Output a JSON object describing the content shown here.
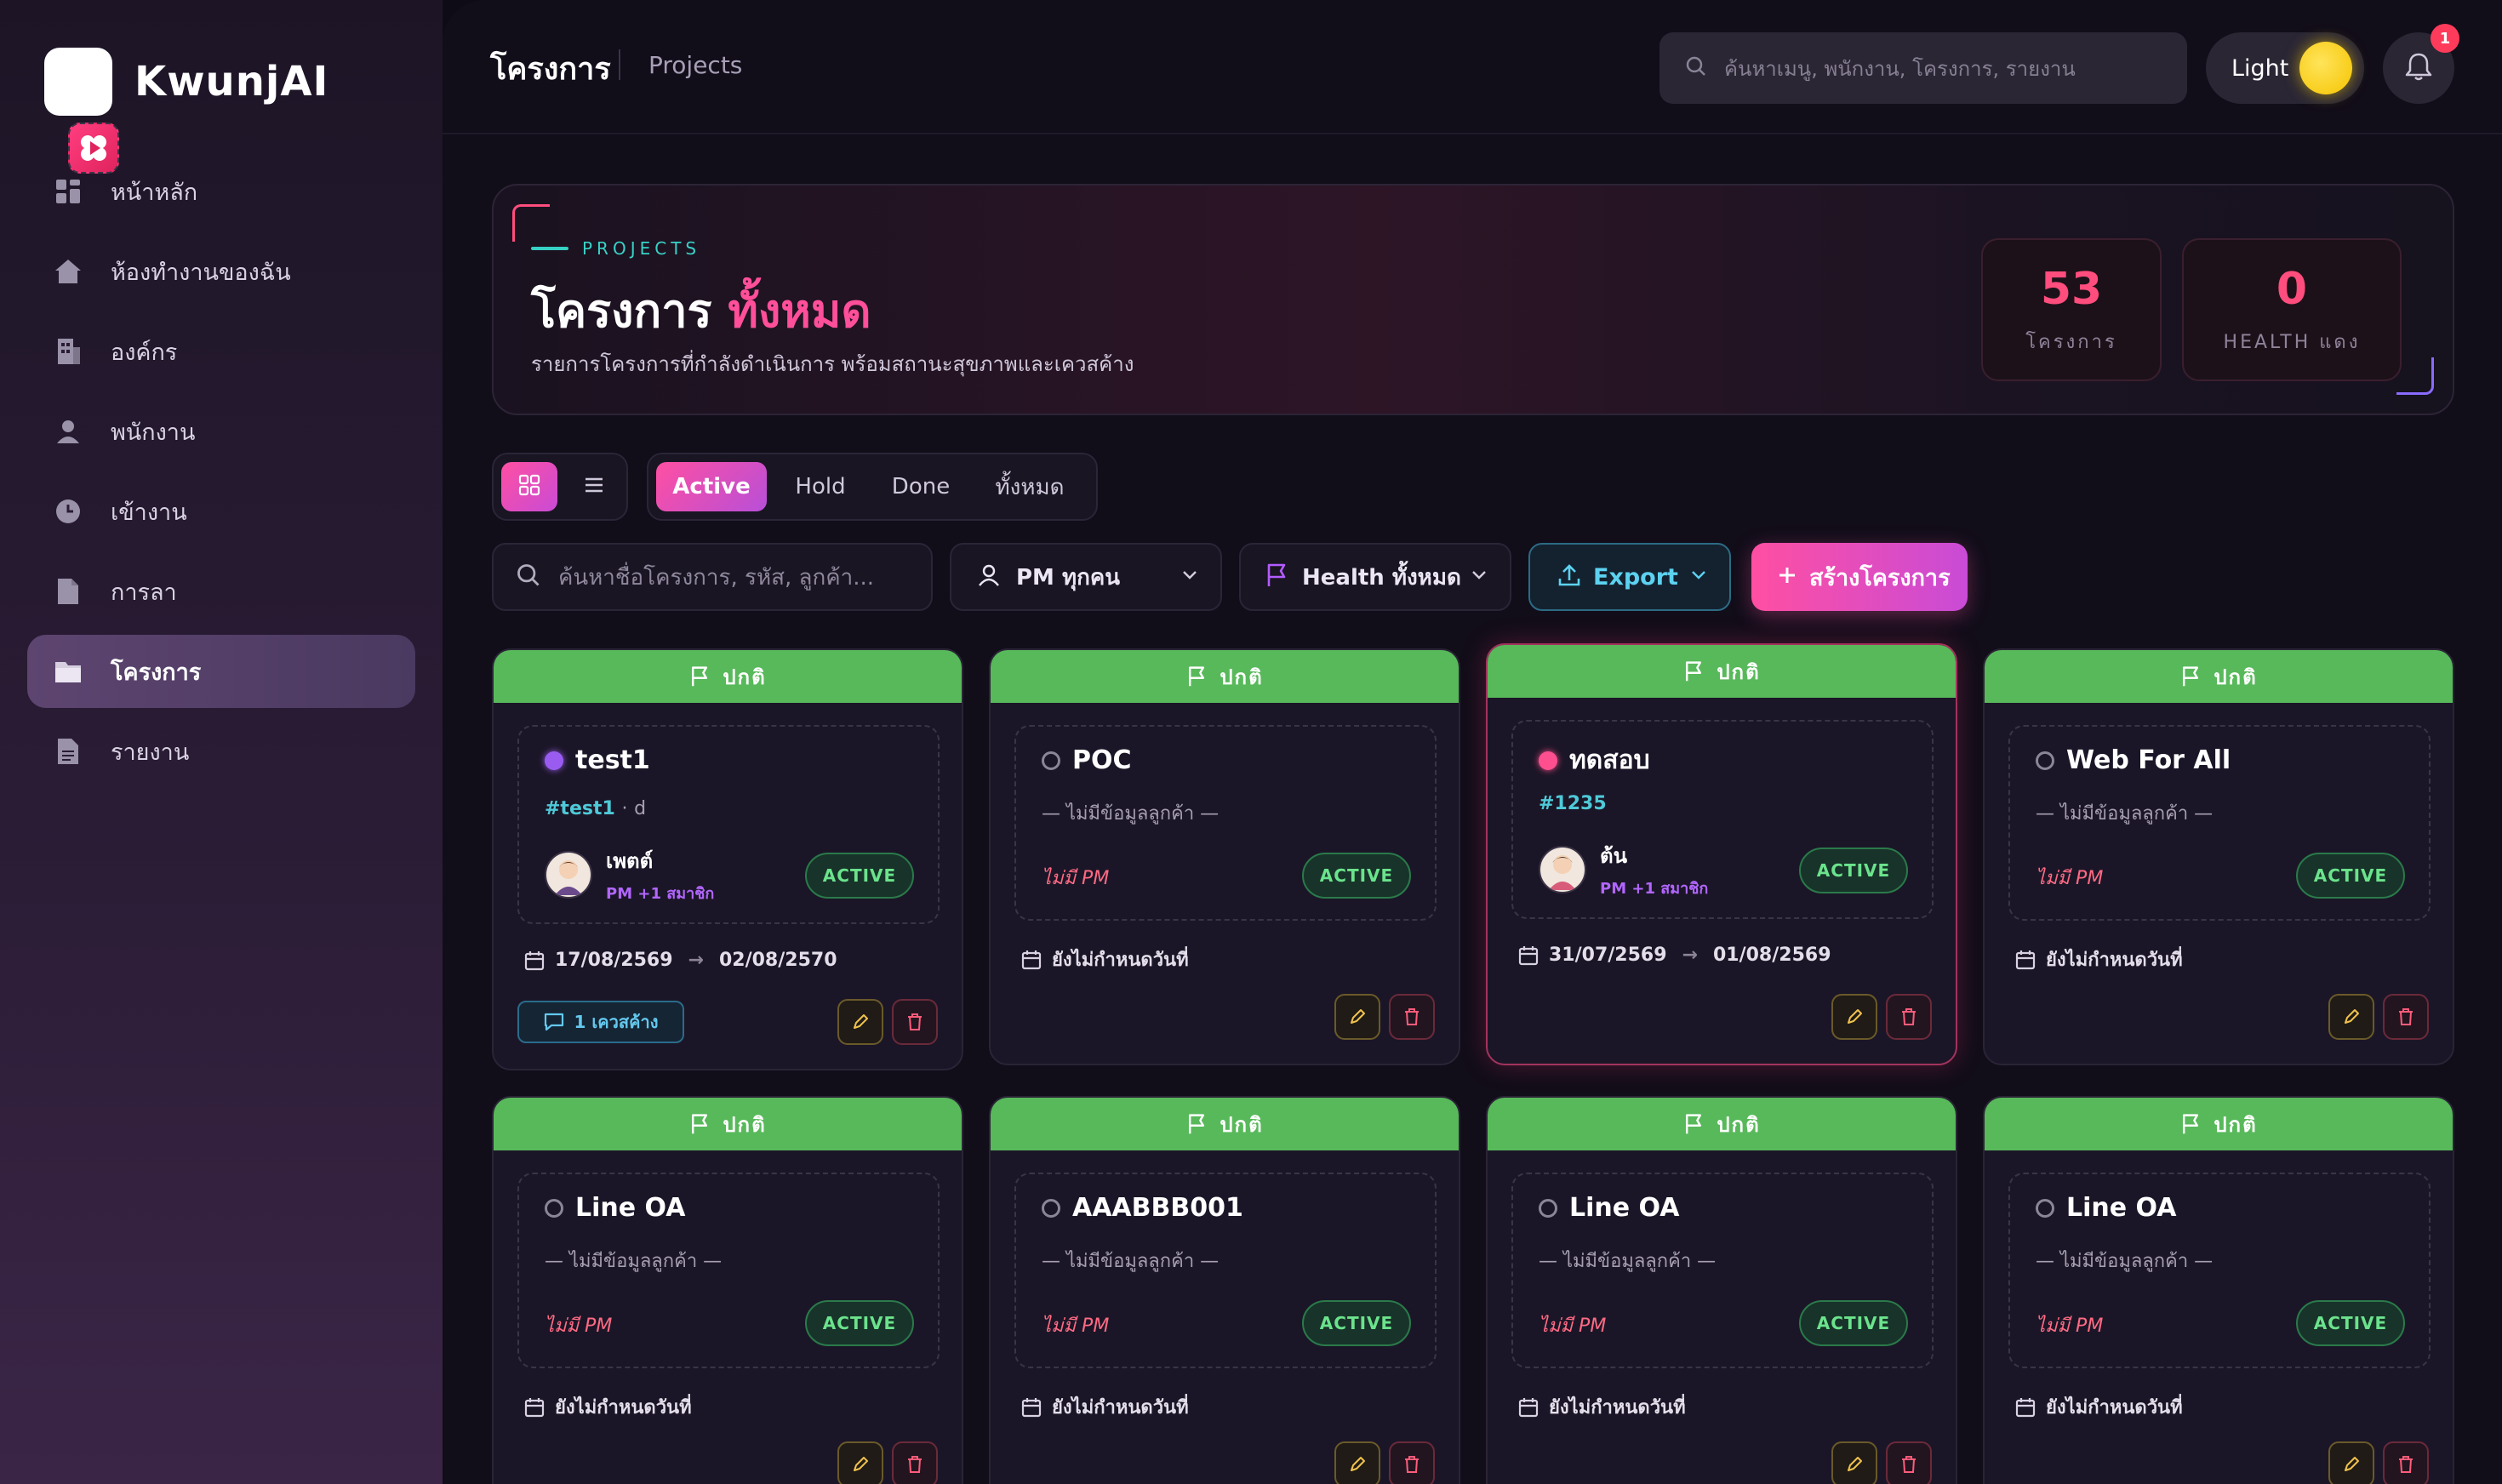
{
  "brand": {
    "name": "KwunjAI"
  },
  "sidebar": {
    "items": [
      {
        "label": "หน้าหลัก",
        "icon": "dashboard-icon"
      },
      {
        "label": "ห้องทำงานของฉัน",
        "icon": "home-icon"
      },
      {
        "label": "องค์กร",
        "icon": "building-icon"
      },
      {
        "label": "พนักงาน",
        "icon": "person-icon"
      },
      {
        "label": "เข้างาน",
        "icon": "clock-icon"
      },
      {
        "label": "การลา",
        "icon": "document-icon"
      },
      {
        "label": "โครงการ",
        "icon": "folder-icon",
        "active": true
      },
      {
        "label": "รายงาน",
        "icon": "report-icon"
      }
    ]
  },
  "topbar": {
    "title": "โครงการ",
    "subtitle": "Projects",
    "search_placeholder": "ค้นหาเมนู, พนักงาน, โครงการ, รายงาน",
    "theme_label": "Light",
    "notification_count": "1"
  },
  "hero": {
    "eyebrow": "PROJECTS",
    "title_main": "โครงการ",
    "title_accent": "ทั้งหมด",
    "description": "รายการโครงการที่กำลังดำเนินการ พร้อมสถานะสุขภาพและเควสค้าง",
    "stats": [
      {
        "value": "53",
        "caption": "โครงการ"
      },
      {
        "value": "0",
        "caption": "HEALTH แดง"
      }
    ]
  },
  "toolbar": {
    "tabs": [
      "Active",
      "Hold",
      "Done",
      "ทั้งหมด"
    ],
    "active_tab": "Active",
    "search_placeholder": "ค้นหาชื่อโครงการ, รหัส, ลูกค้า...",
    "pm_filter": "PM ทุกคน",
    "health_filter": "Health ทั้งหมด",
    "export_label": "Export",
    "create_label": "สร้างโครงการ"
  },
  "card_labels": {
    "health": "ปกติ",
    "status": "ACTIVE",
    "no_client": "— ไม่มีข้อมูลลูกค้า —",
    "no_pm": "ไม่มี PM",
    "no_date": "ยังไม่กำหนดวันที่"
  },
  "projects": [
    {
      "name": "test1",
      "code": "#test1",
      "code_extra": "d",
      "pm": "เพตต์",
      "pm_role": "PM +1 สมาชิก",
      "start": "17/08/2569",
      "end": "02/08/2570",
      "pending": "1 เควสค้าง",
      "dot": "purple"
    },
    {
      "name": "POC",
      "dot": "empty"
    },
    {
      "name": "ทดสอบ",
      "code": "#1235",
      "pm": "ต้น",
      "pm_role": "PM +1 สมาชิก",
      "start": "31/07/2569",
      "end": "01/08/2569",
      "dot": "pink"
    },
    {
      "name": "Web For All",
      "dot": "empty"
    },
    {
      "name": "Line OA",
      "dot": "empty"
    },
    {
      "name": "AAABBB001",
      "dot": "empty"
    },
    {
      "name": "Line OA",
      "dot": "empty"
    },
    {
      "name": "Line OA",
      "dot": "empty"
    }
  ],
  "colors": {
    "accent": "#ff4fa2",
    "health_ok": "#58b95b",
    "teal": "#38d2c6"
  }
}
